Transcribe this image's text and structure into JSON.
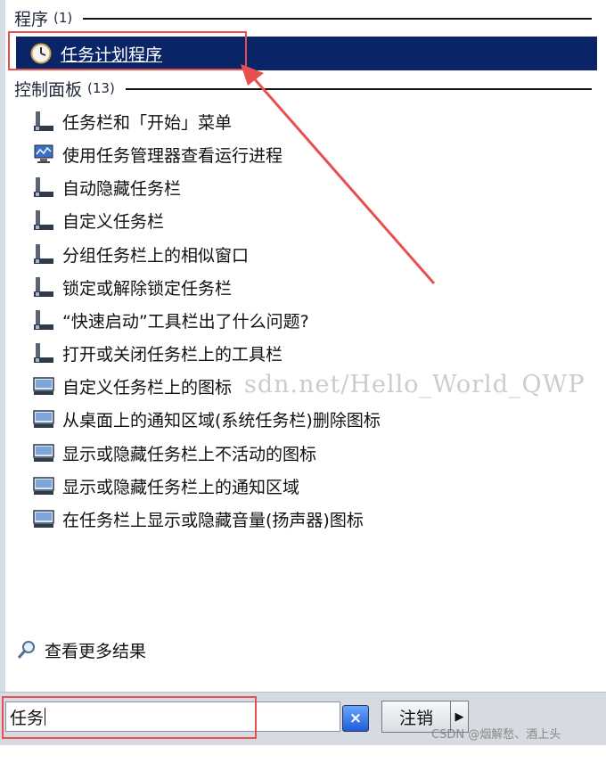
{
  "programs": {
    "title": "程序",
    "count": "(1)",
    "item": "任务计划程序"
  },
  "control_panel": {
    "title": "控制面板",
    "count": "(13)",
    "items": [
      {
        "label": "任务栏和「开始」菜单",
        "icon": "taskbar-icon"
      },
      {
        "label": "使用任务管理器查看运行进程",
        "icon": "task-manager-icon"
      },
      {
        "label": "自动隐藏任务栏",
        "icon": "taskbar-icon"
      },
      {
        "label": "自定义任务栏",
        "icon": "taskbar-icon"
      },
      {
        "label": "分组任务栏上的相似窗口",
        "icon": "taskbar-icon"
      },
      {
        "label": "锁定或解除锁定任务栏",
        "icon": "taskbar-icon"
      },
      {
        "label": "“快速启动”工具栏出了什么问题?",
        "icon": "taskbar-icon"
      },
      {
        "label": "打开或关闭任务栏上的工具栏",
        "icon": "taskbar-icon"
      },
      {
        "label": "自定义任务栏上的图标",
        "icon": "notification-icon"
      },
      {
        "label": "从桌面上的通知区域(系统任务栏)删除图标",
        "icon": "notification-icon"
      },
      {
        "label": "显示或隐藏任务栏上不活动的图标",
        "icon": "notification-icon"
      },
      {
        "label": "显示或隐藏任务栏上的通知区域",
        "icon": "notification-icon"
      },
      {
        "label": "在任务栏上显示或隐藏音量(扬声器)图标",
        "icon": "notification-icon"
      }
    ]
  },
  "see_more": "查看更多结果",
  "search": {
    "value": "任务"
  },
  "buttons": {
    "logoff": "注销",
    "clear": "×",
    "arrow": "▶"
  },
  "watermark": "sdn.net/Hello_World_QWP",
  "credit": "CSDN @烟解愁、酒上头",
  "colors": {
    "selection": "#0a2567",
    "annotation": "#e85050"
  }
}
